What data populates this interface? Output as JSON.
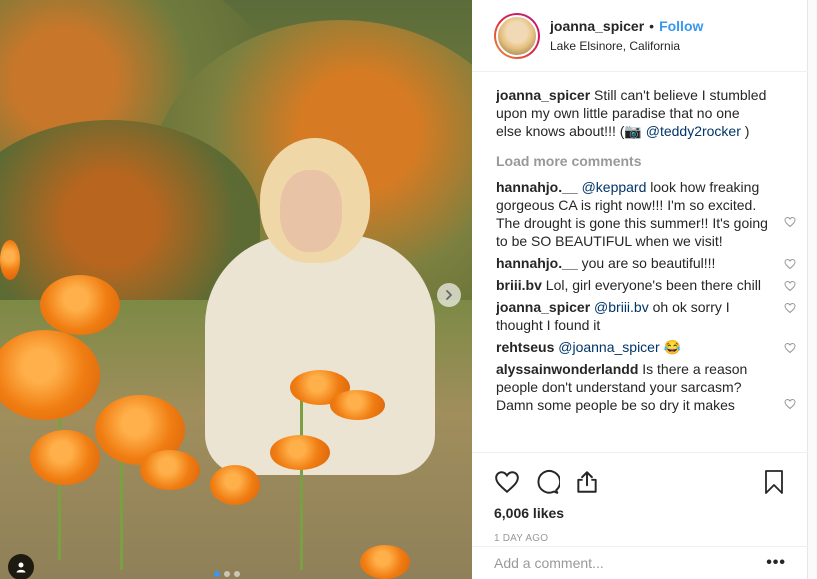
{
  "header": {
    "username": "joanna_spicer",
    "separator": "•",
    "follow_label": "Follow",
    "location": "Lake Elsinore, California"
  },
  "caption": {
    "user": "joanna_spicer",
    "text": "Still can't believe I stumbled upon my own little paradise that no one else knows about!!! (📷",
    "mention": "@teddy2rocker",
    "text_end": ")"
  },
  "load_more_label": "Load more comments",
  "comments": [
    {
      "user": "hannahjo.__",
      "mention": "@keppard",
      "text": "look how freaking gorgeous CA is right now!!! I'm so excited. The drought is gone this summer!! It's going to be SO BEAUTIFUL when we visit!"
    },
    {
      "user": "hannahjo.__",
      "mention": "",
      "text": "you are so beautiful!!!"
    },
    {
      "user": "briii.bv",
      "mention": "",
      "text": "Lol, girl everyone's been there chill"
    },
    {
      "user": "joanna_spicer",
      "mention": "@briii.bv",
      "text": "oh ok sorry I thought I found it"
    },
    {
      "user": "rehtseus",
      "mention": "@joanna_spicer",
      "text": "😂"
    },
    {
      "user": "alyssainwonderlandd",
      "mention": "",
      "text": "Is there a reason people don't understand your sarcasm? Damn some people be so dry it makes"
    }
  ],
  "likes": "6,006 likes",
  "timestamp": "1 DAY AGO",
  "add_comment": {
    "placeholder": "Add a comment...",
    "more_label": "•••"
  },
  "icons": {
    "like": "heart-icon",
    "comment": "comment-icon",
    "share": "share-icon",
    "save": "bookmark-icon",
    "next": "chevron-right-icon",
    "tag": "user-tag-icon"
  },
  "colors": {
    "accent": "#3897f0",
    "text": "#262626",
    "muted": "#999999"
  },
  "carousel": {
    "slides": 3,
    "active": 1
  }
}
